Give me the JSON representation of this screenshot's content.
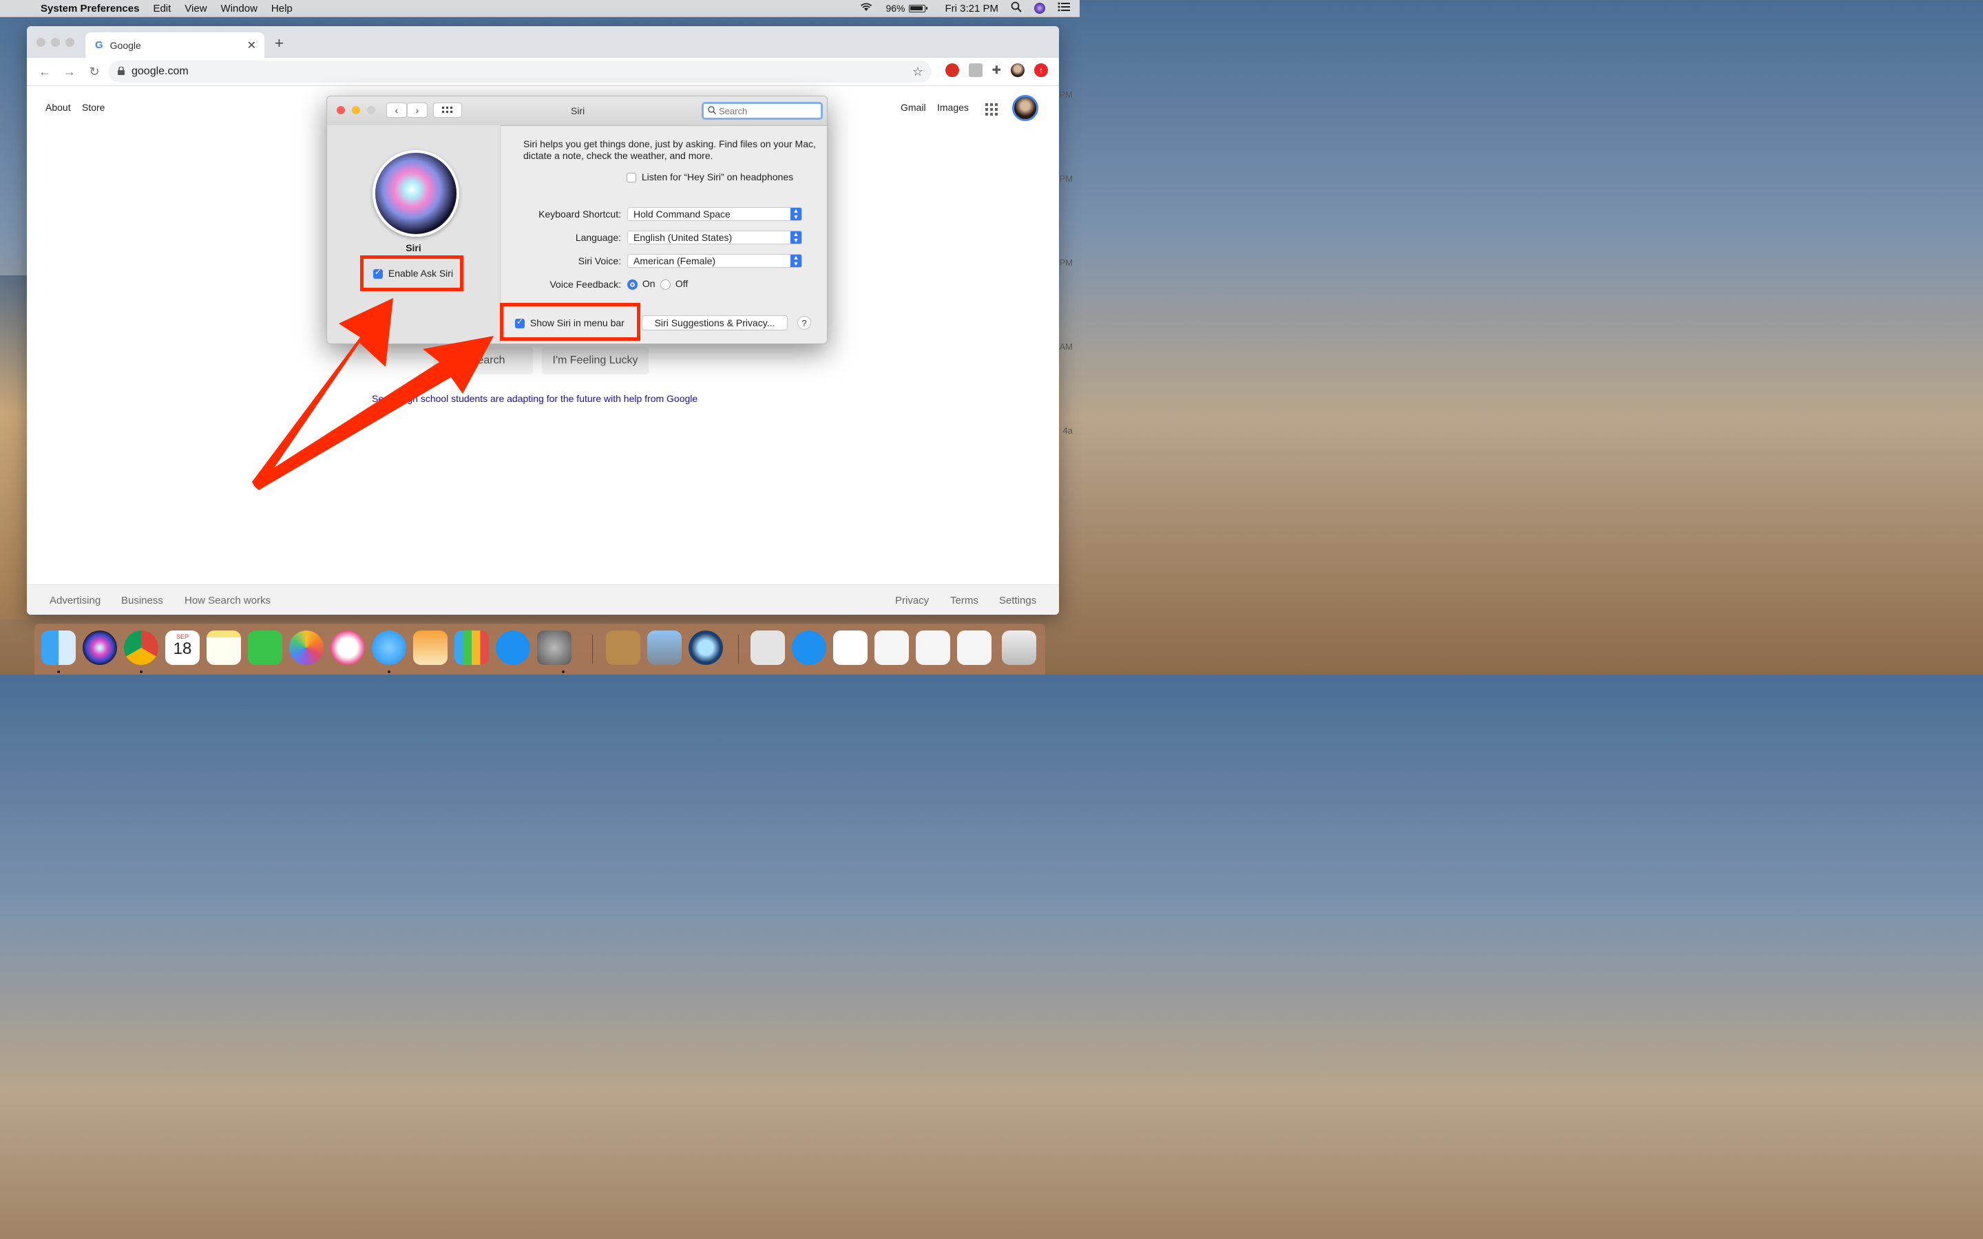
{
  "menubar": {
    "app_name": "System Preferences",
    "items": [
      "Edit",
      "View",
      "Window",
      "Help"
    ],
    "battery": "96%",
    "clock": "Fri 3:21 PM"
  },
  "browser": {
    "tab_title": "Google",
    "tab_favicon": "G",
    "url": "google.com"
  },
  "google": {
    "top_left_links": [
      "About",
      "Store"
    ],
    "top_right_links": [
      "Gmail",
      "Images"
    ],
    "buttons": [
      "e Search",
      "I'm Feeling Lucky"
    ],
    "promo_link": "Se      high school students are adapting for the future with help from Google",
    "footer_left": [
      "Advertising",
      "Business",
      "How Search works"
    ],
    "footer_right": [
      "Privacy",
      "Terms",
      "Settings"
    ]
  },
  "desktop_edge_text": [
    "PM",
    "PM",
    "PM",
    "AM",
    "4a"
  ],
  "prefs": {
    "title": "Siri",
    "search_placeholder": "Search",
    "panel_name": "Siri",
    "enable_label": "Enable Ask Siri",
    "description": "Siri helps you get things done, just by asking. Find files on your Mac, dictate a note, check the weather, and more.",
    "hey_siri_label": "Listen for “Hey Siri” on headphones",
    "keyboard_shortcut_label": "Keyboard Shortcut:",
    "keyboard_shortcut_value": "Hold Command Space",
    "language_label": "Language:",
    "language_value": "English (United States)",
    "voice_label": "Siri Voice:",
    "voice_value": "American (Female)",
    "feedback_label": "Voice Feedback:",
    "feedback_on": "On",
    "feedback_off": "Off",
    "menu_bar_label": "Show Siri in menu bar",
    "suggestions_button": "Siri Suggestions & Privacy...",
    "help": "?"
  },
  "colors": {
    "highlight": "#ff2a00",
    "accent": "#3478f6",
    "link": "#1a0dab"
  },
  "dock": {
    "calendar_month": "SEP",
    "calendar_day": "18"
  }
}
